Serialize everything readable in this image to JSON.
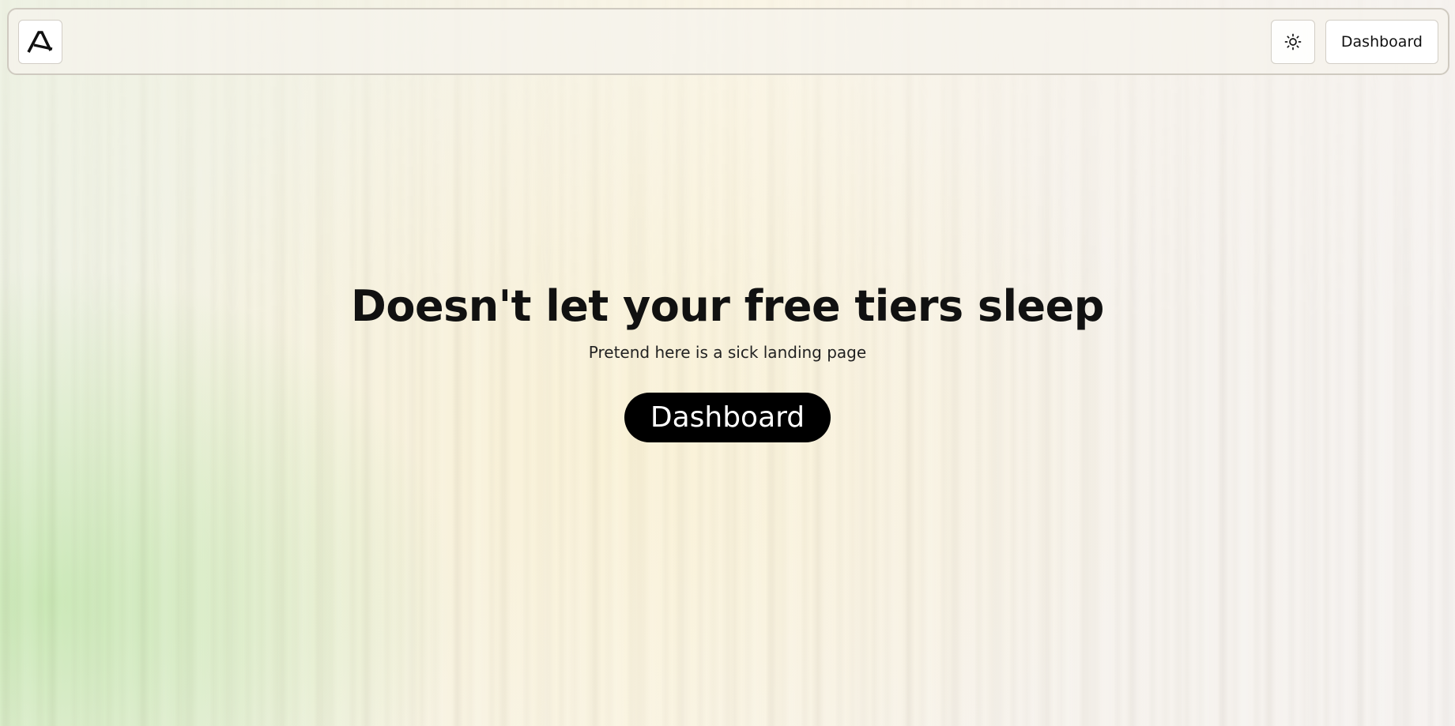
{
  "navbar": {
    "logo_icon": "brand-logo-a-icon",
    "theme_toggle_icon": "sun-icon",
    "dashboard_label": "Dashboard"
  },
  "hero": {
    "title": "Doesn't let your free tiers sleep",
    "subtitle": "Pretend here is a sick landing page",
    "cta_label": "Dashboard"
  },
  "colors": {
    "primary_button_bg": "#000000",
    "primary_button_text": "#ffffff",
    "text": "#111111",
    "border": "#d2cec6"
  }
}
